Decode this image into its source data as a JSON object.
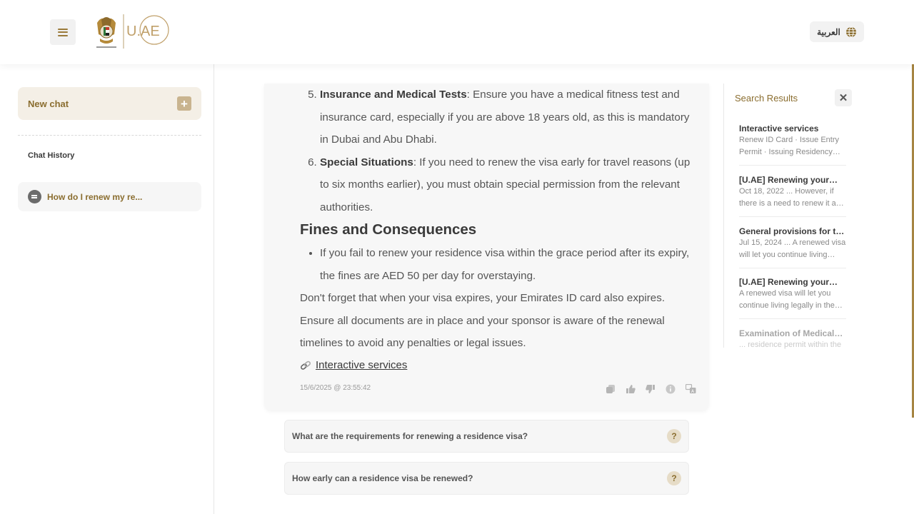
{
  "header": {
    "menu_icon": "hamburger-menu-icon",
    "logo_text": "U.AE",
    "language_label": "العربية",
    "language_icon": "globe-icon"
  },
  "sidebar": {
    "new_chat_label": "New chat",
    "new_chat_icon": "plus-icon",
    "history_title": "Chat History",
    "history": [
      {
        "label": "How do I renew my re...",
        "icon": "chat-bubble-icon"
      }
    ]
  },
  "message": {
    "list_items": [
      {
        "number": 5,
        "bold": "Insurance and Medical Tests",
        "text": ": Ensure you have a medical fitness test and insurance card, especially if you are above 18 years old, as this is mandatory in Dubai and Abu Dhabi."
      },
      {
        "number": 6,
        "bold": "Special Situations",
        "text": ": If you need to renew the visa early for travel reasons (up to six months earlier), you must obtain special permission from the relevant authorities."
      }
    ],
    "section_heading": "Fines and Consequences",
    "bullet": "If you fail to renew your residence visa within the grace period after its expiry, the fines are AED 50 per day for overstaying.",
    "closing": "Don't forget that when your visa expires, your Emirates ID card also expires. Ensure all documents are in place and your sponsor is aware of the renewal timelines to avoid any penalties or legal issues.",
    "link_label": " Interactive services",
    "timestamp": "15/6/2025 @ 23:55:42",
    "actions": [
      "copy-icon",
      "thumbs-up-icon",
      "thumbs-down-icon",
      "info-icon",
      "translate-icon"
    ]
  },
  "suggestions": [
    {
      "label": "What are the requirements for renewing a residence visa?",
      "icon": "question-icon"
    },
    {
      "label": "How early can a residence visa be renewed?",
      "icon": "question-icon"
    }
  ],
  "search_results": {
    "title": "Search Results",
    "close_icon": "close-icon",
    "items": [
      {
        "title": "Interactive services",
        "snippet": "Renew ID Card · Issue Entry Permit · Issuing Residency…"
      },
      {
        "title": "[U.AE] Renewing your…",
        "snippet": "Oct 18, 2022 ... However, if there is a need to renew it a…"
      },
      {
        "title": "General provisions for t…",
        "snippet": "Jul 15, 2024 ... A renewed visa will let you continue living…"
      },
      {
        "title": "[U.AE] Renewing your…",
        "snippet": "A renewed visa will let you continue living legally in the…"
      },
      {
        "title": "Examination of Medical…",
        "snippet": "... residence permit within the"
      }
    ]
  },
  "colors": {
    "accent_gold": "#8a6d2f",
    "scrollbar": "#a68542"
  }
}
